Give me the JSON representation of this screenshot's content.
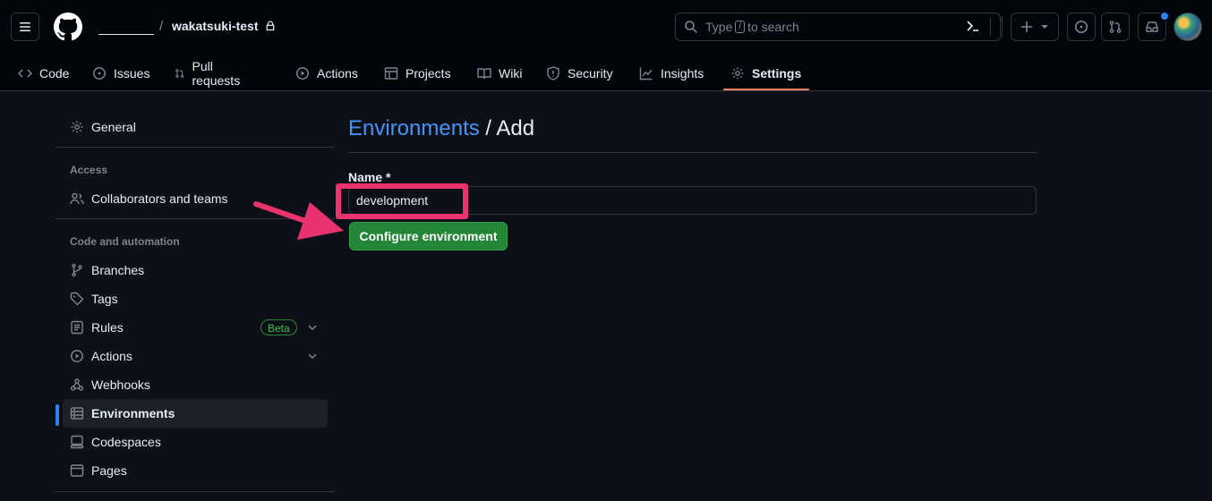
{
  "header": {
    "repo_name": "wakatsuki-test",
    "separator": "/",
    "search": {
      "prefix": "Type",
      "key": "/",
      "suffix": "to search"
    }
  },
  "repo_nav": {
    "tabs": [
      {
        "label": "Code",
        "icon": "code-icon"
      },
      {
        "label": "Issues",
        "icon": "issue-icon"
      },
      {
        "label": "Pull requests",
        "icon": "pull-request-icon"
      },
      {
        "label": "Actions",
        "icon": "play-icon"
      },
      {
        "label": "Projects",
        "icon": "table-icon"
      },
      {
        "label": "Wiki",
        "icon": "book-icon"
      },
      {
        "label": "Security",
        "icon": "shield-icon"
      },
      {
        "label": "Insights",
        "icon": "graph-icon"
      },
      {
        "label": "Settings",
        "icon": "gear-icon",
        "selected": true
      }
    ]
  },
  "sidebar": {
    "general": "General",
    "access_heading": "Access",
    "collaborators": "Collaborators and teams",
    "code_heading": "Code and automation",
    "items": [
      {
        "label": "Branches",
        "icon": "branch-icon"
      },
      {
        "label": "Tags",
        "icon": "tag-icon"
      },
      {
        "label": "Rules",
        "icon": "rules-icon",
        "badge": "Beta"
      },
      {
        "label": "Actions",
        "icon": "play-icon"
      },
      {
        "label": "Webhooks",
        "icon": "webhook-icon"
      },
      {
        "label": "Environments",
        "icon": "server-icon",
        "active": true
      },
      {
        "label": "Codespaces",
        "icon": "codespaces-icon"
      },
      {
        "label": "Pages",
        "icon": "browser-icon"
      }
    ]
  },
  "main": {
    "breadcrumb_link": "Environments",
    "breadcrumb_current": "/ Add",
    "name_label": "Name *",
    "name_value": "development",
    "configure_button": "Configure environment"
  },
  "colors": {
    "background": "#0d1117",
    "header": "#010409",
    "accent_link": "#4493f8",
    "primary_button": "#238636",
    "annotation": "#e8336f",
    "selected_tab_underline": "#f78166"
  }
}
